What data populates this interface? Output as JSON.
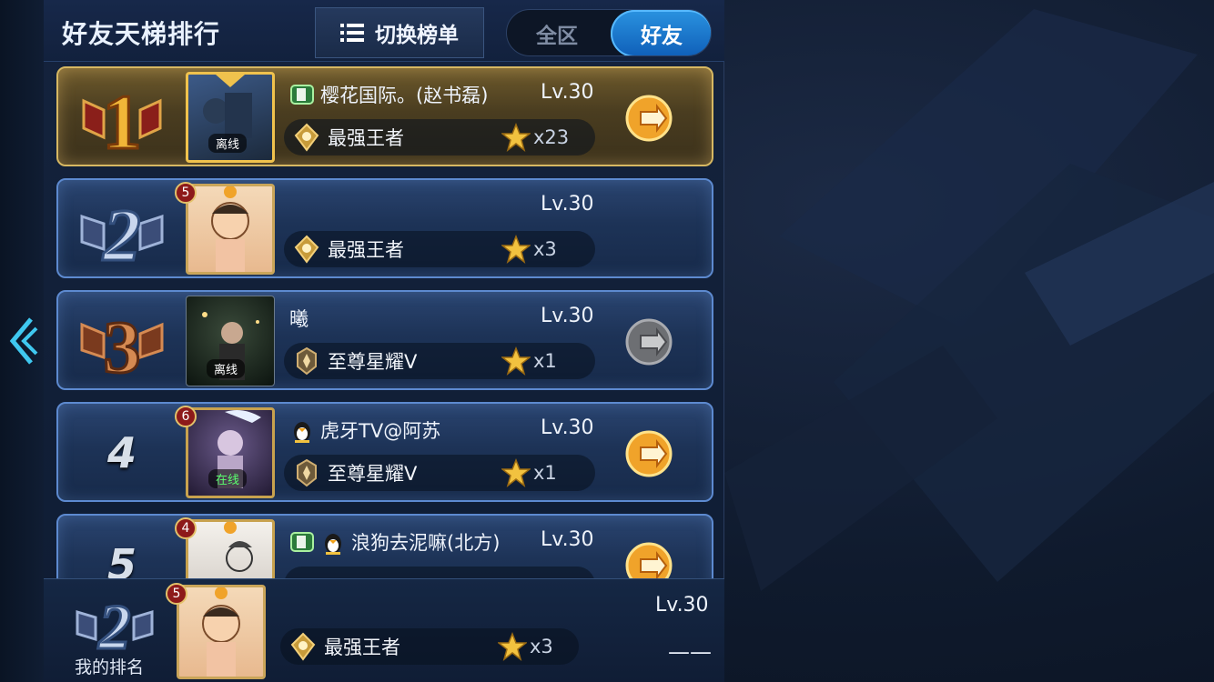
{
  "header": {
    "title": "好友天梯排行",
    "switch_label": "切换榜单",
    "scope_all": "全区",
    "scope_friends": "好友"
  },
  "icons": {
    "back": "double-chevron-left-icon",
    "list": "list-icon",
    "king_tier": "king-tier-emblem-icon",
    "glory_tier": "star-glory-tier-emblem-icon",
    "star": "gold-star-icon",
    "send": "send-coin-icon"
  },
  "colors": {
    "accent": "#2a93e0",
    "gold_border": "#d7b862",
    "row_border": "#5d8ad0",
    "online": "#5aff6d"
  },
  "rows": [
    {
      "rank": "1",
      "name": "樱花国际。(赵书磊)",
      "level": "Lv.30",
      "tier": "最强王者",
      "stars": "x23",
      "status": "离线"
    },
    {
      "rank": "2",
      "name": "",
      "level": "Lv.30",
      "tier": "最强王者",
      "stars": "x3",
      "badge": "5"
    },
    {
      "rank": "3",
      "name": "曦",
      "level": "Lv.30",
      "tier": "至尊星耀V",
      "stars": "x1",
      "status": "离线"
    },
    {
      "rank": "4",
      "name": "虎牙TV@阿苏",
      "level": "Lv.30",
      "tier": "至尊星耀V",
      "stars": "x1",
      "status": "在线",
      "badge": "6"
    },
    {
      "rank": "5",
      "name": "浪狗去泥嘛(北方)",
      "level": "Lv.30",
      "badge": "4"
    }
  ],
  "me": {
    "label": "我的排名",
    "level": "Lv.30",
    "tier": "最强王者",
    "stars": "x3",
    "badge": "5",
    "placeholder": "——"
  }
}
